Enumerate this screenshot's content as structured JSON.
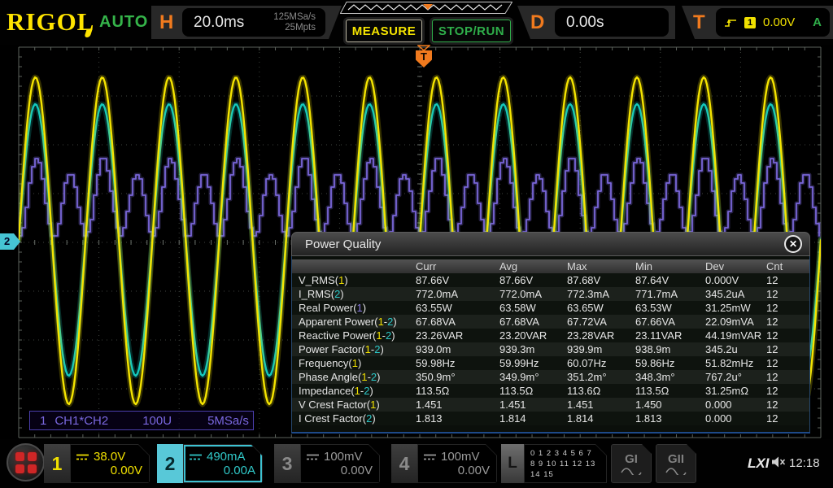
{
  "top_bar": {
    "logo": "RIGOL",
    "mode": "AUTO",
    "h_label": "H",
    "timebase": "20.0ms",
    "sample_rate": "125MSa/s",
    "mem_depth": "25Mpts",
    "measure_label": "MEASURE",
    "stoprun_label": "STOP/RUN",
    "d_label": "D",
    "delay": "0.00s",
    "t_label": "T",
    "trigger_source": "1",
    "trigger_level": "0.00V",
    "trigger_sweep": "A"
  },
  "waveform": {
    "left_marker": "2",
    "trigger_marker": "T",
    "math_label": {
      "num": "1",
      "expr": "CH1*CH2",
      "scale": "100U",
      "rate": "5MSa/s"
    },
    "colors": {
      "ch1": "#f5e400",
      "ch2": "#14c8bc",
      "math": "#7866d8",
      "grid_dot": "#3f443f",
      "tick": "#5c625c"
    }
  },
  "panel": {
    "title": "Power Quality",
    "close": "✕",
    "columns": [
      "",
      "Curr",
      "Avg",
      "Max",
      "Min",
      "Dev",
      "Cnt"
    ],
    "ref_colors": {
      "y": "#f0e000",
      "c": "#2cc8c8",
      "m": "#8a7ae0",
      "w": "#e6e6e6"
    },
    "rows": [
      {
        "label": "V_RMS",
        "refs": [
          [
            "1",
            "y"
          ]
        ],
        "values": [
          "87.66V",
          "87.66V",
          "87.68V",
          "87.64V",
          "0.000V",
          "12"
        ]
      },
      {
        "label": "I_RMS",
        "refs": [
          [
            "2",
            "c"
          ]
        ],
        "values": [
          "772.0mA",
          "772.0mA",
          "772.3mA",
          "771.7mA",
          "345.2uA",
          "12"
        ]
      },
      {
        "label": "Real Power",
        "refs": [
          [
            "1",
            "m"
          ]
        ],
        "values": [
          "63.55W",
          "63.58W",
          "63.65W",
          "63.53W",
          "31.25mW",
          "12"
        ]
      },
      {
        "label": "Apparent Power",
        "refs": [
          [
            "1",
            "y"
          ],
          [
            "2",
            "c"
          ]
        ],
        "values": [
          "67.68VA",
          "67.68VA",
          "67.72VA",
          "67.66VA",
          "22.09mVA",
          "12"
        ]
      },
      {
        "label": "Reactive Power",
        "refs": [
          [
            "1",
            "y"
          ],
          [
            "2",
            "c"
          ]
        ],
        "values": [
          "23.26VAR",
          "23.20VAR",
          "23.28VAR",
          "23.11VAR",
          "44.19mVAR",
          "12"
        ]
      },
      {
        "label": "Power Factor",
        "refs": [
          [
            "1",
            "y"
          ],
          [
            "2",
            "c"
          ]
        ],
        "values": [
          "939.0m",
          "939.3m",
          "939.9m",
          "938.9m",
          "345.2u",
          "12"
        ]
      },
      {
        "label": "Frequency",
        "refs": [
          [
            "1",
            "y"
          ]
        ],
        "values": [
          "59.98Hz",
          "59.99Hz",
          "60.07Hz",
          "59.86Hz",
          "51.82mHz",
          "12"
        ]
      },
      {
        "label": "Phase Angle",
        "refs": [
          [
            "1",
            "y"
          ],
          [
            "2",
            "c"
          ]
        ],
        "values": [
          "350.9m°",
          "349.9m°",
          "351.2m°",
          "348.3m°",
          "767.2u°",
          "12"
        ]
      },
      {
        "label": "Impedance",
        "refs": [
          [
            "1",
            "y"
          ],
          [
            "2",
            "c"
          ]
        ],
        "values": [
          "113.5Ω",
          "113.5Ω",
          "113.6Ω",
          "113.5Ω",
          "31.25mΩ",
          "12"
        ]
      },
      {
        "label": "V Crest Factor",
        "refs": [
          [
            "1",
            "y"
          ]
        ],
        "values": [
          "1.451",
          "1.451",
          "1.451",
          "1.450",
          "0.000",
          "12"
        ]
      },
      {
        "label": "I Crest Factor",
        "refs": [
          [
            "2",
            "c"
          ]
        ],
        "values": [
          "1.813",
          "1.814",
          "1.814",
          "1.813",
          "0.000",
          "12"
        ]
      }
    ]
  },
  "bottom_bar": {
    "channels": [
      {
        "num": "1",
        "scale": "38.0V",
        "offset": "0.00V",
        "state": "on"
      },
      {
        "num": "2",
        "scale": "490mA",
        "offset": "0.00A",
        "state": "sel"
      },
      {
        "num": "3",
        "scale": "100mV",
        "offset": "0.00V",
        "state": "off"
      },
      {
        "num": "4",
        "scale": "100mV",
        "offset": "0.00V",
        "state": "off"
      }
    ],
    "logic": {
      "label": "L",
      "row1": "0 1 2 3  4 5 6 7",
      "row2": "8 9 10 11 12 13 14 15"
    },
    "gen1": "GI",
    "gen2": "GII",
    "lxi": "LXI",
    "time": "12:18"
  }
}
